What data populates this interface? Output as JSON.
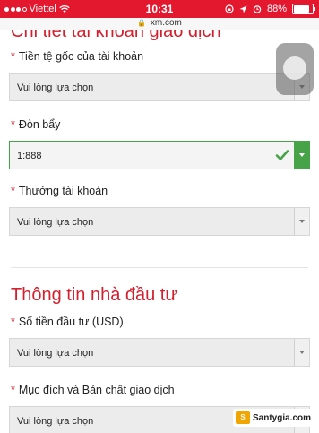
{
  "status_bar": {
    "carrier": "Viettel",
    "time": "10:31",
    "battery_percent": "88%",
    "battery_level": 0.88
  },
  "browser": {
    "url": "xm.com"
  },
  "form": {
    "partial_section_title": "Chi tiết tài khoản giao dịch",
    "fields": [
      {
        "label": "Tiền tệ gốc của tài khoản",
        "value": "Vui lòng lựa chọn"
      },
      {
        "label": "Đòn bẩy",
        "value": "1:888",
        "valid": true
      },
      {
        "label": "Thưởng tài khoản",
        "value": "Vui lòng lựa chọn"
      }
    ],
    "section2_title": "Thông tin nhà đầu tư",
    "fields2": [
      {
        "label": "Số tiền đầu tư (USD)",
        "value": "Vui lòng lựa chọn"
      },
      {
        "label": "Mục đích và Bản chất giao dịch",
        "value": "Vui lòng lựa chọn"
      }
    ],
    "required_marker": "*"
  },
  "watermark": {
    "text": "Santygia.com",
    "icon_text": "S"
  },
  "colors": {
    "accent": "#d3202e",
    "status_bar": "#e3182f",
    "valid": "#46a347"
  }
}
